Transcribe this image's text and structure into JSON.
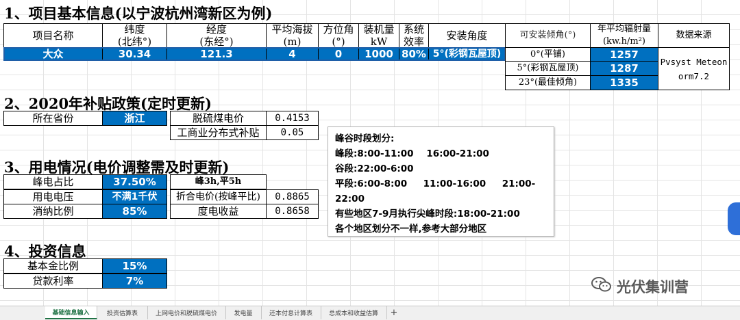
{
  "section1": {
    "title": "1、项目基本信息(以宁波杭州湾新区为例)"
  },
  "table1": {
    "headers": [
      "项目名称",
      "纬度\n(北纬°)",
      "经度\n(东经°)",
      "平均海拔\n(m)",
      "方位角\n(°)",
      "装机量\nkW",
      "系统\n效率",
      "安装角度",
      "可安装倾角(°)",
      "年平均辐射量\n(kw.h/m²)",
      "数据来源"
    ],
    "row": {
      "name": "大众",
      "lat": "30.34",
      "lon": "121.3",
      "alt": "4",
      "azimuth": "0",
      "capacity": "1000",
      "efficiency": "80%",
      "angle": "5°(彩钢瓦屋顶)"
    },
    "tilts": [
      {
        "label": "0°(平铺)",
        "value": "1257"
      },
      {
        "label": "5°(彩钢瓦屋顶)",
        "value": "1287"
      },
      {
        "label": "23°(最佳倾角)",
        "value": "1335"
      }
    ],
    "source": "Pvsyst Meteonorm7.2"
  },
  "section2": {
    "title": "2、2020年补贴政策(定时更新)"
  },
  "policy": {
    "province_label": "所在省份",
    "province": "浙江",
    "coal_label": "脱硫煤电价",
    "coal": "0.4153",
    "subsidy_label": "工商业分布式补贴",
    "subsidy": "0.05"
  },
  "section3": {
    "title": "3、用电情况(电价调整需及时更新)"
  },
  "usage": {
    "peak_label": "峰电占比",
    "peak": "37.50%",
    "peak_note": "峰3h,平5h",
    "voltage_label": "用电电压",
    "voltage": "不满1千伏",
    "combined_label": "折合电价(按峰平比)",
    "combined": "0.8865",
    "consume_label": "消纳比例",
    "consume": "85%",
    "income_label": "度电收益",
    "income": "0.8658"
  },
  "note": {
    "lines": [
      "峰谷时段划分:",
      "峰段:8:00-11:00    16:00-21:00",
      "谷段:22:00-6:00",
      "平段:6:00-8:00     11:00-16:00     21:00-",
      "22:00",
      "有些地区7-9月执行尖峰时段:18:00-21:00",
      "各个地区划分不一样,参考大部分地区"
    ]
  },
  "section4": {
    "title": "4、投资信息"
  },
  "invest": {
    "equity_label": "基本金比例",
    "equity": "15%",
    "rate_label": "贷款利率",
    "rate": "7%"
  },
  "watermark": {
    "text": "光伏集训营",
    "icon": "wechat-icon"
  },
  "tabs": [
    "基础信息输入",
    "投资估算表",
    "上网电价和脱硫煤电价",
    "发电量",
    "还本付息计算表",
    "总成本和收益估算",
    "+"
  ],
  "colors": {
    "accent": "#0070c0",
    "tab_active": "#217346"
  }
}
